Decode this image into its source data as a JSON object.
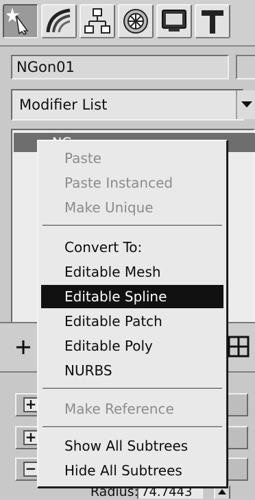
{
  "command_panel": {
    "tabs": [
      {
        "icon": "create-icon",
        "active": true
      },
      {
        "icon": "modify-icon",
        "active": false
      },
      {
        "icon": "hierarchy-icon",
        "active": false
      },
      {
        "icon": "motion-icon",
        "active": false
      },
      {
        "icon": "display-icon",
        "active": false
      },
      {
        "icon": "utilities-icon",
        "active": false
      }
    ],
    "object_name": "NGon01",
    "modifier_list": "Modifier List",
    "stack_item": "NG"
  },
  "context_menu": {
    "paste": "Paste",
    "paste_instanced": "Paste Instanced",
    "make_unique": "Make Unique",
    "convert_to": "Convert To:",
    "editable_mesh": "Editable Mesh",
    "editable_spline": "Editable Spline",
    "editable_patch": "Editable Patch",
    "editable_poly": "Editable Poly",
    "nurbs": "NURBS",
    "make_reference": "Make Reference",
    "show_all_subtrees": "Show All Subtrees",
    "hide_all_subtrees": "Hide All Subtrees",
    "selected_item": "Editable Spline"
  },
  "parameters": {
    "radius_label": "Radius:",
    "radius_value": "74.7443"
  },
  "colors": {
    "menu_bg": "#e9e9e9",
    "highlight": "#111111",
    "disabled_text": "#8c8c8c"
  }
}
